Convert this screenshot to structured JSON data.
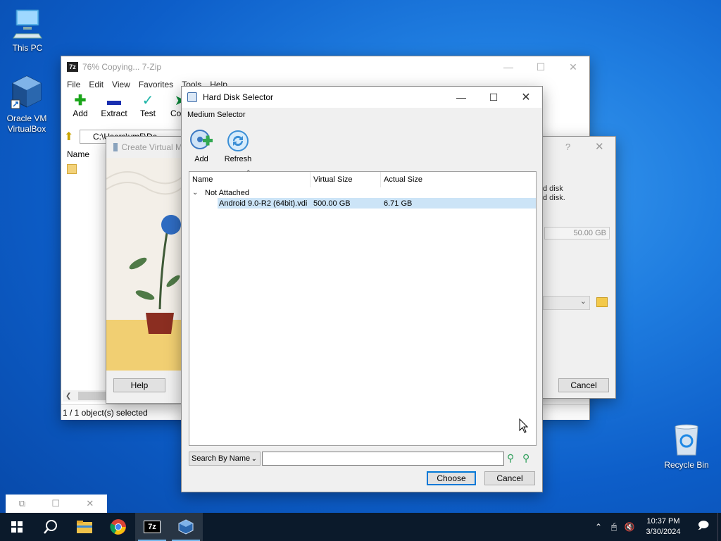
{
  "desktop": {
    "icons": [
      {
        "label": "This PC",
        "icon": "this-pc-icon"
      },
      {
        "label": "Oracle VM VirtualBox",
        "icon": "virtualbox-icon"
      },
      {
        "label": "Recycle Bin",
        "icon": "recycle-bin-icon"
      }
    ]
  },
  "zip_window": {
    "title": "76% Copying... 7-Zip",
    "menu": [
      "File",
      "Edit",
      "View",
      "Favorites",
      "Tools",
      "Help"
    ],
    "toolbar": [
      "Add",
      "Extract",
      "Test",
      "Copy"
    ],
    "path": "C:\\Users\\vm5\\De",
    "column_name": "Name",
    "status": "1 / 1 object(s) selected"
  },
  "create_vm_window": {
    "title": "Create Virtual M",
    "help_label": "Help"
  },
  "settings_window": {
    "help_symbol": "?",
    "text_line1": "d disk",
    "text_line2": "d disk.",
    "size_value": "50.00 GB",
    "cancel_label": "Cancel"
  },
  "hard_disk_selector": {
    "title": "Hard Disk Selector",
    "subtitle": "Medium Selector",
    "toolbar": {
      "add_label": "Add",
      "refresh_label": "Refresh"
    },
    "columns": [
      "Name",
      "Virtual Size",
      "Actual Size"
    ],
    "group_label": "Not Attached",
    "rows": [
      {
        "name": "Android 9.0-R2 (64bit).vdi",
        "virtual_size": "500.00 GB",
        "actual_size": "6.71 GB"
      }
    ],
    "search_mode": "Search By Name",
    "search_value": "",
    "choose_label": "Choose",
    "cancel_label": "Cancel"
  },
  "taskbar": {
    "time": "10:37 PM",
    "date": "3/30/2024",
    "apps": [
      "start-icon",
      "search-icon",
      "file-explorer-icon",
      "chrome-icon",
      "7zip-icon",
      "virtualbox-icon"
    ]
  },
  "colors": {
    "selection": "#cce4f7",
    "taskbar": "#0b1a2b",
    "accent": "#0078d7"
  }
}
